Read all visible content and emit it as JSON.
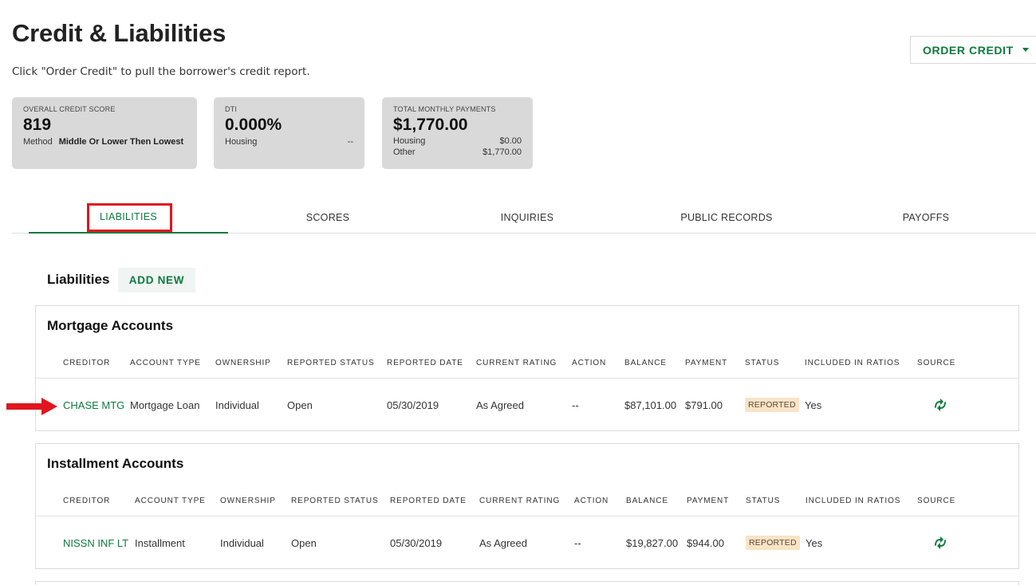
{
  "header": {
    "title": "Credit & Liabilities",
    "subtitle": "Click \"Order Credit\" to pull the borrower's credit report.",
    "order_button": "ORDER CREDIT"
  },
  "cards": {
    "credit_score": {
      "label": "OVERALL CREDIT SCORE",
      "value": "819",
      "method_label": "Method",
      "method_value": "Middle Or Lower Then Lowest"
    },
    "dti": {
      "label": "DTI",
      "value": "0.000%",
      "housing_label": "Housing",
      "housing_value": "--"
    },
    "monthly": {
      "label": "TOTAL MONTHLY PAYMENTS",
      "value": "$1,770.00",
      "housing_label": "Housing",
      "housing_value": "$0.00",
      "other_label": "Other",
      "other_value": "$1,770.00"
    }
  },
  "tabs": [
    "LIABILITIES",
    "SCORES",
    "INQUIRIES",
    "PUBLIC RECORDS",
    "PAYOFFS"
  ],
  "liabilities": {
    "title": "Liabilities",
    "add_new": "ADD NEW"
  },
  "columns": [
    "CREDITOR",
    "ACCOUNT TYPE",
    "OWNERSHIP",
    "REPORTED STATUS",
    "REPORTED DATE",
    "CURRENT RATING",
    "ACTION",
    "BALANCE",
    "PAYMENT",
    "STATUS",
    "INCLUDED IN RATIOS",
    "SOURCE"
  ],
  "mortgage": {
    "title": "Mortgage Accounts",
    "row": {
      "creditor": "CHASE MTG",
      "account_type": "Mortgage Loan",
      "ownership": "Individual",
      "reported_status": "Open",
      "reported_date": "05/30/2019",
      "current_rating": "As Agreed",
      "action": "--",
      "balance": "$87,101.00",
      "payment": "$791.00",
      "status": "REPORTED",
      "included": "Yes",
      "source_icon": "credit-sync-icon"
    }
  },
  "installment": {
    "title": "Installment Accounts",
    "row": {
      "creditor": "NISSN INF LT",
      "account_type": "Installment",
      "ownership": "Individual",
      "reported_status": "Open",
      "reported_date": "05/30/2019",
      "current_rating": "As Agreed",
      "action": "--",
      "balance": "$19,827.00",
      "payment": "$944.00",
      "status": "REPORTED",
      "included": "Yes",
      "source_icon": "credit-sync-icon"
    }
  },
  "colors": {
    "accent": "#0d7a3e",
    "highlight": "#e0151f",
    "badge_bg": "#fbe3c6",
    "card_bg": "#d9d9d9"
  }
}
